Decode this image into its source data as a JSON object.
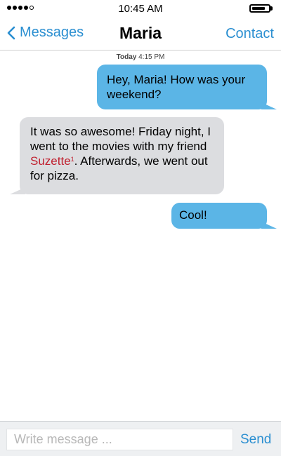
{
  "status_bar": {
    "time": "10:45 AM",
    "signal": {
      "filled_dots": 4,
      "total_dots": 5,
      "icon": "signal-dots-icon"
    },
    "battery": {
      "level": 0.8,
      "icon": "battery-icon"
    }
  },
  "nav": {
    "back_label": "Messages",
    "back_icon": "chevron-left-icon",
    "title": "Maria",
    "contact_label": "Contact"
  },
  "conversation": {
    "timestamp_day": "Today",
    "timestamp_time": "4:15 PM",
    "messages": [
      {
        "direction": "sent",
        "text": "Hey, Maria! How was your weekend?"
      },
      {
        "direction": "received",
        "text_before": "It was so awesome! Friday night, I went to the movies with my friend ",
        "highlight": "Suzette",
        "footnote": "1",
        "text_after": ". Afterwards, we went out for pizza."
      },
      {
        "direction": "sent",
        "text": "Cool!"
      }
    ]
  },
  "input": {
    "placeholder": "Write message ...",
    "value": "",
    "send_label": "Send"
  },
  "colors": {
    "accent": "#2b8fd1",
    "sent_bubble": "#5bb5e6",
    "received_bubble": "#dcdde0",
    "highlight": "#c0202f",
    "input_bar_bg": "#eef0f2"
  }
}
